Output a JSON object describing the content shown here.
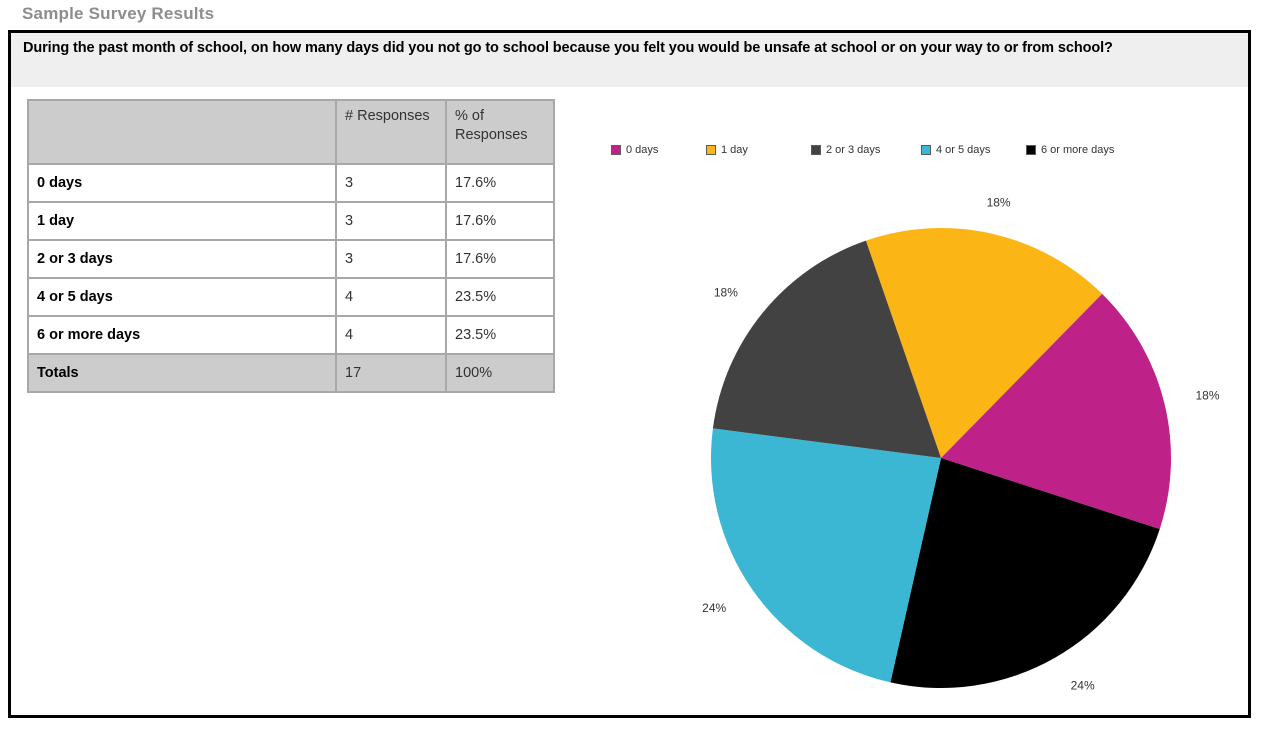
{
  "page": {
    "title": "Sample Survey Results"
  },
  "question": {
    "text": "During the past month of school, on how many days did you not go to school because you felt you would be unsafe at school or on your way to or from school?"
  },
  "table": {
    "headers": {
      "category": "",
      "count": "# Responses",
      "percent": "% of Responses"
    },
    "rows": [
      {
        "label": "0 days",
        "count": "3",
        "percent": "17.6%"
      },
      {
        "label": "1 day",
        "count": "3",
        "percent": "17.6%"
      },
      {
        "label": "2 or 3 days",
        "count": "3",
        "percent": "17.6%"
      },
      {
        "label": "4 or 5 days",
        "count": "4",
        "percent": "23.5%"
      },
      {
        "label": "6 or more days",
        "count": "4",
        "percent": "23.5%"
      }
    ],
    "totals": {
      "label": "Totals",
      "count": "17",
      "percent": "100%"
    }
  },
  "chart_data": {
    "type": "pie",
    "title": "",
    "legend_position": "top",
    "categories": [
      "0 days",
      "1 day",
      "2 or 3 days",
      "4 or 5 days",
      "6 or more days"
    ],
    "values": [
      3,
      3,
      3,
      4,
      4
    ],
    "percents": [
      17.6,
      17.6,
      17.6,
      23.5,
      23.5
    ],
    "data_labels": [
      "18%",
      "18%",
      "18%",
      "24%",
      "24%"
    ],
    "total": 17,
    "colors": [
      "#BE2288",
      "#FBB615",
      "#424242",
      "#3CB7D3",
      "#000000"
    ],
    "slices": [
      {
        "label": "0 days",
        "value": 3,
        "percent": 17.6,
        "data_label": "18%",
        "color": "#BE2288",
        "label_pos": "right"
      },
      {
        "label": "1 day",
        "value": 3,
        "percent": 17.6,
        "data_label": "18%",
        "color": "#FBB615",
        "label_pos": "top-right"
      },
      {
        "label": "2 or 3 days",
        "value": 3,
        "percent": 17.6,
        "data_label": "18%",
        "color": "#424242",
        "label_pos": "top-left"
      },
      {
        "label": "4 or 5 days",
        "value": 4,
        "percent": 23.5,
        "data_label": "24%",
        "color": "#3CB7D3",
        "label_pos": "bottom-left"
      },
      {
        "label": "6 or more days",
        "value": 4,
        "percent": 23.5,
        "data_label": "24%",
        "color": "#000000",
        "label_pos": "bottom-right"
      }
    ]
  },
  "colors": {
    "panel_border": "#000000",
    "banner_bg": "#efefef",
    "table_grid": "#a8a8a8",
    "table_header_bg": "#cccccc",
    "title_text": "#8d8d8d"
  }
}
